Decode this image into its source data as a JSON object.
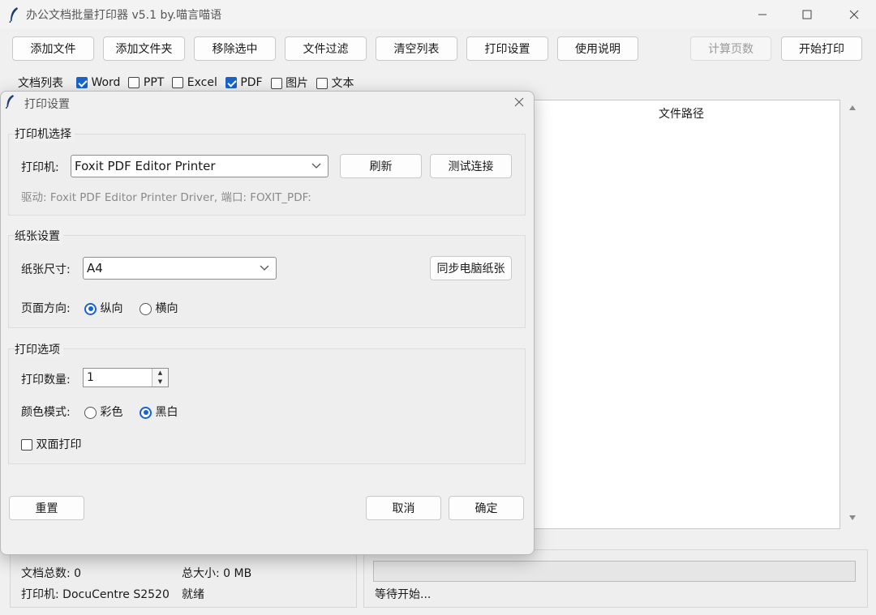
{
  "window": {
    "title": "办公文档批量打印器 v5.1 by.喵言喵语"
  },
  "toolbar": {
    "add_file": "添加文件",
    "add_folder": "添加文件夹",
    "remove_selected": "移除选中",
    "file_filter": "文件过滤",
    "clear_list": "清空列表",
    "print_settings": "打印设置",
    "help": "使用说明",
    "count_pages": "计算页数",
    "start_print": "开始打印"
  },
  "filters": {
    "label": "文档列表",
    "items": [
      {
        "label": "Word",
        "checked": true
      },
      {
        "label": "PPT",
        "checked": false
      },
      {
        "label": "Excel",
        "checked": false
      },
      {
        "label": "PDF",
        "checked": true
      },
      {
        "label": "图片",
        "checked": false
      },
      {
        "label": "文本",
        "checked": false
      }
    ]
  },
  "file_list": {
    "column_header": "文件路径"
  },
  "status": {
    "doc_count": "文档总数: 0",
    "total_size": "总大小: 0 MB",
    "printer": "打印机: DocuCentre S2520",
    "state": "就绪",
    "progress_text": "等待开始...",
    "progress_percent": 0
  },
  "dialog": {
    "title": "打印设置",
    "printer_group": {
      "title": "打印机选择",
      "printer_label": "打印机:",
      "printer_value": "Foxit PDF Editor Printer",
      "refresh": "刷新",
      "test_connection": "测试连接",
      "driver_info": "驱动: Foxit PDF Editor Printer Driver, 端口: FOXIT_PDF:"
    },
    "paper_group": {
      "title": "纸张设置",
      "size_label": "纸张尺寸:",
      "size_value": "A4",
      "sync_paper": "同步电脑纸张",
      "orientation_label": "页面方向:",
      "portrait": "纵向",
      "landscape": "横向",
      "orientation_selected": "portrait"
    },
    "options_group": {
      "title": "打印选项",
      "copies_label": "打印数量:",
      "copies_value": "1",
      "color_label": "颜色模式:",
      "color": "彩色",
      "mono": "黑白",
      "color_selected": "mono",
      "duplex_label": "双面打印",
      "duplex_checked": false
    },
    "buttons": {
      "reset": "重置",
      "cancel": "取消",
      "ok": "确定"
    }
  }
}
